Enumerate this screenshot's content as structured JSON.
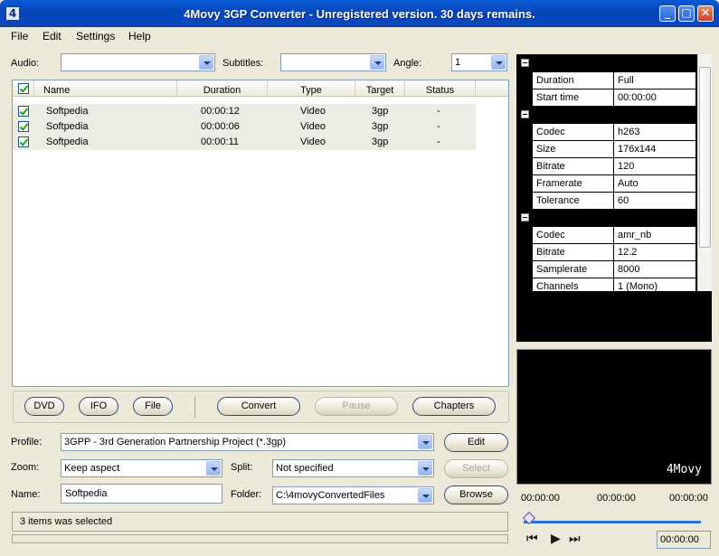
{
  "window": {
    "title": "4Movy 3GP Converter - Unregistered version. 30 days remains.",
    "icon_glyph": "4",
    "controls": {
      "minimize": "_",
      "maximize": "□",
      "close": "✕"
    }
  },
  "menu": [
    "File",
    "Edit",
    "Settings",
    "Help"
  ],
  "top_controls": {
    "audio_label": "Audio:",
    "audio_value": "",
    "subtitles_label": "Subtitles:",
    "subtitles_value": "",
    "angle_label": "Angle:",
    "angle_value": "1"
  },
  "file_list": {
    "columns": [
      "Name",
      "Duration",
      "Type",
      "Target",
      "Status"
    ],
    "rows": [
      {
        "name": "Softpedia",
        "duration": "00:00:12",
        "type": "Video",
        "target": "3gp",
        "status": "-"
      },
      {
        "name": "Softpedia",
        "duration": "00:00:06",
        "type": "Video",
        "target": "3gp",
        "status": "-"
      },
      {
        "name": "Softpedia",
        "duration": "00:00:11",
        "type": "Video",
        "target": "3gp",
        "status": "-"
      }
    ]
  },
  "toolbar": {
    "dvd": "DVD",
    "ifo": "IFO",
    "file": "File",
    "convert": "Convert",
    "pause": "Pause",
    "chapters": "Chapters"
  },
  "settings": {
    "profile_label": "Profile:",
    "profile_value": "3GPP - 3rd Generation Partnership Project (*.3gp)",
    "edit_button": "Edit",
    "zoom_label": "Zoom:",
    "zoom_value": "Keep aspect",
    "split_label": "Split:",
    "split_value": "Not specified",
    "select_button": "Select",
    "name_label": "Name:",
    "name_value": "Softpedia",
    "folder_label": "Folder:",
    "folder_value": "C:\\4movyConvertedFiles",
    "browse_button": "Browse"
  },
  "status": {
    "text": "3 items was selected",
    "progress": 0
  },
  "properties": {
    "general": [
      {
        "key": "Duration",
        "value": "Full"
      },
      {
        "key": "Start time",
        "value": "00:00:00"
      }
    ],
    "video": [
      {
        "key": "Codec",
        "value": "h263"
      },
      {
        "key": "Size",
        "value": "176x144"
      },
      {
        "key": "Bitrate",
        "value": "120"
      },
      {
        "key": "Framerate",
        "value": "Auto"
      },
      {
        "key": "Tolerance",
        "value": "60"
      }
    ],
    "audio": [
      {
        "key": "Codec",
        "value": "amr_nb"
      },
      {
        "key": "Bitrate",
        "value": "12.2"
      },
      {
        "key": "Samplerate",
        "value": "8000"
      },
      {
        "key": "Channels",
        "value": "1 (Mono)"
      }
    ]
  },
  "preview": {
    "watermark": "4Movy",
    "time_start": "00:00:00",
    "time_mid": "00:00:00",
    "time_end": "00:00:00",
    "position_time": "00:00:00",
    "playback_position": 0
  },
  "colors": {
    "titlebar": "#0546b8",
    "accent": "#2a6fd6",
    "panel": "#ece9d8"
  }
}
